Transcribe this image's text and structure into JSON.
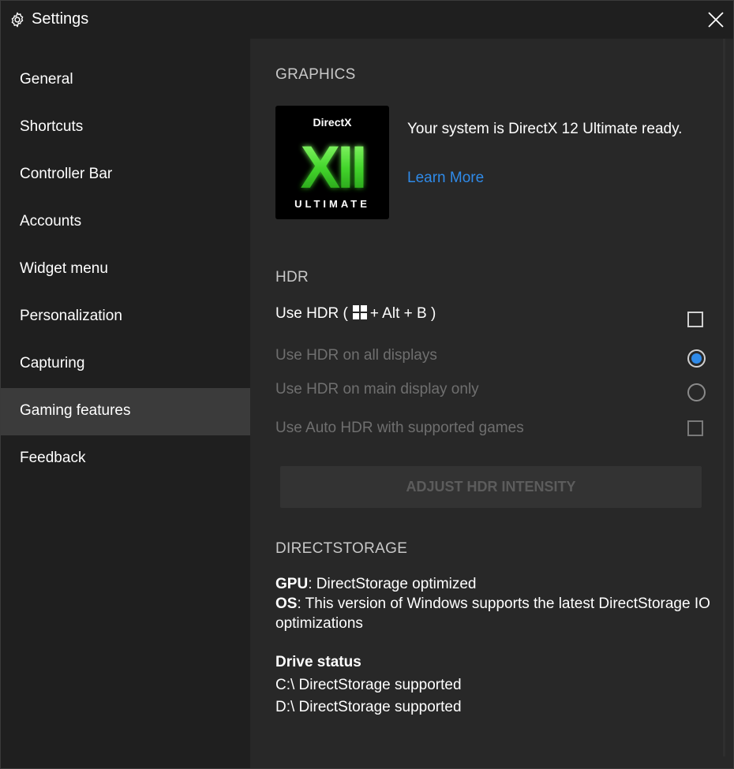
{
  "window": {
    "title": "Settings"
  },
  "sidebar": {
    "items": [
      {
        "label": "General"
      },
      {
        "label": "Shortcuts"
      },
      {
        "label": "Controller Bar"
      },
      {
        "label": "Accounts"
      },
      {
        "label": "Widget menu"
      },
      {
        "label": "Personalization"
      },
      {
        "label": "Capturing"
      },
      {
        "label": "Gaming features",
        "active": true
      },
      {
        "label": "Feedback"
      }
    ]
  },
  "graphics": {
    "heading": "GRAPHICS",
    "logo_top": "DirectX",
    "logo_mark": "XII",
    "logo_bottom": "ULTIMATE",
    "status_text": "Your system is DirectX 12 Ultimate ready.",
    "learn_more": "Learn More"
  },
  "hdr": {
    "heading": "HDR",
    "use_hdr_prefix": "Use HDR (",
    "use_hdr_suffix": "+ Alt + B )",
    "use_hdr_checked": false,
    "all_displays_label": "Use HDR on all displays",
    "all_displays_selected": true,
    "main_display_label": "Use HDR on main display only",
    "main_display_selected": false,
    "auto_hdr_label": "Use Auto HDR with supported games",
    "auto_hdr_checked": false,
    "adjust_button": "ADJUST HDR INTENSITY"
  },
  "directstorage": {
    "heading": "DIRECTSTORAGE",
    "gpu_label": "GPU",
    "gpu_value": ": DirectStorage optimized",
    "os_label": "OS",
    "os_value": ": This version of Windows supports the latest DirectStorage IO optimizations",
    "drive_status_heading": "Drive status",
    "drives": [
      "C:\\ DirectStorage supported",
      "D:\\ DirectStorage supported"
    ]
  },
  "colors": {
    "accent": "#2f8ae8",
    "dx_green": "#44d62c",
    "content_bg": "#282828",
    "sidebar_bg": "#1f1f1f",
    "active_item_bg": "#3b3b3b"
  }
}
